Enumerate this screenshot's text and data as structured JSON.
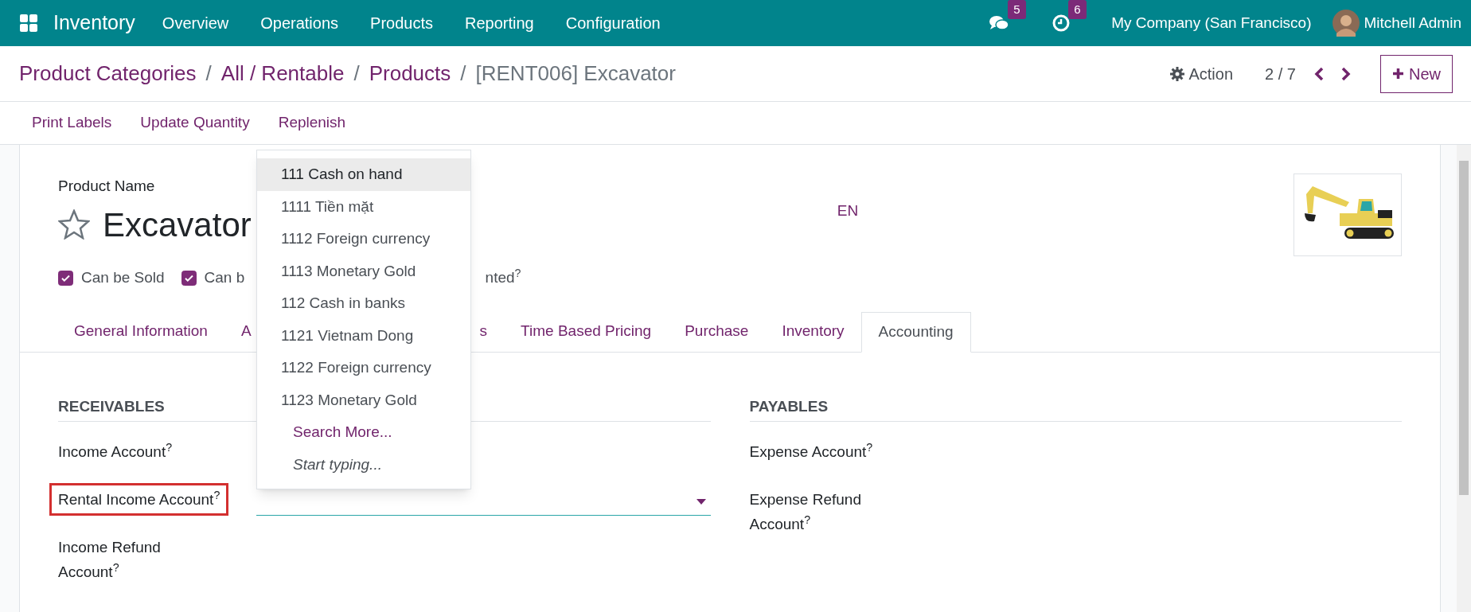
{
  "navbar": {
    "app_name": "Inventory",
    "menu": [
      "Overview",
      "Operations",
      "Products",
      "Reporting",
      "Configuration"
    ],
    "messages_badge": "5",
    "activities_badge": "6",
    "company": "My Company (San Francisco)",
    "user": "Mitchell Admin"
  },
  "breadcrumb": {
    "links": [
      "Product Categories",
      "All / Rentable",
      "Products"
    ],
    "separators": [
      "/",
      "/",
      "/"
    ],
    "current": "[RENT006] Excavator"
  },
  "control_panel": {
    "action": "Action",
    "pager": "2 / 7",
    "new_button": "New"
  },
  "action_buttons": [
    "Print Labels",
    "Update Quantity",
    "Replenish"
  ],
  "form": {
    "name_label": "Product Name",
    "name": "Excavator",
    "favorite": false,
    "language": "EN",
    "options": [
      {
        "label": "Can be Sold",
        "checked": true,
        "clipped": false
      },
      {
        "label": "Can b",
        "checked": true,
        "clipped": true
      }
    ],
    "option_fragment": "nted$^{?}$",
    "tabs": [
      {
        "label": "General Information",
        "selected": false,
        "cut_end": false,
        "cut_start": false
      },
      {
        "label": "A",
        "selected": false,
        "cut_end": true,
        "cut_start": false
      },
      {
        "label": "s",
        "selected": false,
        "cut_end": false,
        "cut_start": true
      },
      {
        "label": "Time Based Pricing",
        "selected": false,
        "cut_end": false,
        "cut_start": false
      },
      {
        "label": "Purchase",
        "selected": false,
        "cut_end": false,
        "cut_start": false
      },
      {
        "label": "Inventory",
        "selected": false,
        "cut_end": false,
        "cut_start": false
      },
      {
        "label": "Accounting",
        "selected": true,
        "cut_end": false,
        "cut_start": false
      }
    ],
    "sections": [
      {
        "title": "RECEIVABLES",
        "fields": [
          {
            "lines": [
              "Income Account$^{?}$"
            ],
            "highlighted": false,
            "focused": false
          },
          {
            "lines": [
              "Rental Income Account$^{?}$"
            ],
            "highlighted": true,
            "focused": true
          },
          {
            "lines": [
              "Income Refund",
              "Account$^{?}$"
            ],
            "highlighted": false,
            "focused": false
          }
        ]
      },
      {
        "title": "PAYABLES",
        "fields": [
          {
            "lines": [
              "Expense Account$^{?}$"
            ],
            "highlighted": false,
            "focused": false
          },
          {
            "lines": [
              "Expense Refund",
              "Account$^{?}$"
            ],
            "highlighted": false,
            "focused": false
          }
        ]
      }
    ]
  },
  "dropdown": {
    "options": [
      {
        "label": "111 Cash on hand",
        "selected": true
      },
      {
        "label": "1111 Tiền mặt",
        "selected": false
      },
      {
        "label": "1112 Foreign currency",
        "selected": false
      },
      {
        "label": "1113 Monetary Gold",
        "selected": false
      },
      {
        "label": "112 Cash in banks",
        "selected": false
      },
      {
        "label": "1121 Vietnam Dong",
        "selected": false
      },
      {
        "label": "1122 Foreign currency",
        "selected": false
      },
      {
        "label": "1123 Monetary Gold",
        "selected": false
      }
    ],
    "search_more": "Search More...",
    "hint": "Start typing..."
  }
}
